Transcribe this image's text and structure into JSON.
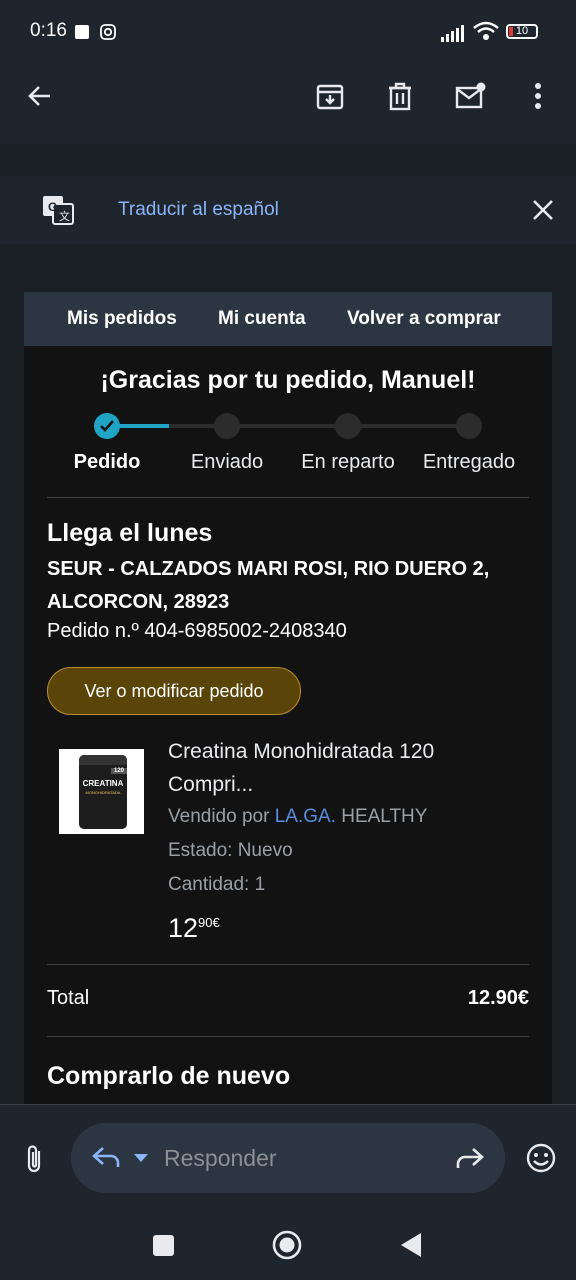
{
  "status_bar": {
    "time": "0:16",
    "battery": "10"
  },
  "translate": {
    "label": "Traducir al español"
  },
  "email_nav": {
    "links": [
      "Mis pedidos",
      "Mi cuenta",
      "Volver a comprar"
    ]
  },
  "order": {
    "heading": "¡Gracias por tu pedido, Manuel!",
    "steps": [
      "Pedido",
      "Enviado",
      "En reparto",
      "Entregado"
    ],
    "current_step": 1,
    "arrival": "Llega el lunes",
    "address_line1": "SEUR - CALZADOS MARI ROSI, RIO DUERO 2,",
    "address_line2": "ALCORCON, 28923",
    "order_number": "Pedido n.º 404-6985002-2408340",
    "modify_button": "Ver o modificar pedido"
  },
  "product": {
    "title_line1": "Creatina Monohidratada 120",
    "title_line2": "Compri...",
    "sold_by_prefix": "Vendido por ",
    "seller_link": "LA.GA.",
    "seller_rest": " HEALTHY",
    "condition": "Estado: Nuevo",
    "quantity": "Cantidad: 1",
    "price_whole": "12",
    "price_fraction": "90€",
    "image_label_brand": "CREATINA",
    "image_label_sub": "MONOHIDRATADA",
    "image_badge": "120"
  },
  "summary": {
    "total_label": "Total",
    "total_value": "12.90€",
    "buy_again": "Comprarlo de nuevo"
  },
  "reply": {
    "placeholder": "Responder"
  },
  "colors": {
    "accent": "#20a4c4",
    "link": "#8ab4f8",
    "button_bg": "#5b4408",
    "button_border": "#b8912f"
  }
}
